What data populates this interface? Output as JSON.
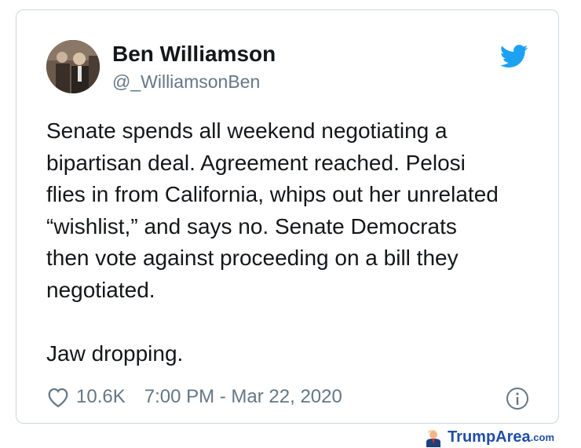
{
  "tweet": {
    "author": {
      "display_name": "Ben Williamson",
      "handle": "@_WilliamsonBen"
    },
    "text_lines": [
      "Senate spends all weekend negotiating a",
      "bipartisan deal. Agreement reached. Pelosi",
      "flies in from California, whips out her unrelated",
      "“wishlist,” and says no. Senate Democrats",
      "then vote against proceeding on a bill they",
      "negotiated."
    ],
    "text_closing": "Jaw dropping.",
    "likes": "10.6K",
    "timestamp": "7:00 PM - Mar 22, 2020",
    "icons": {
      "brand": "twitter-bird-icon",
      "like": "heart-icon",
      "info": "info-icon"
    }
  },
  "watermark": {
    "name": "TrumpArea",
    "tld": ".com",
    "icon": "trump-figure-icon"
  },
  "colors": {
    "twitter_blue": "#1da1f2",
    "text_primary": "#14171a",
    "text_secondary": "#657786",
    "card_border": "#cfd6dc",
    "watermark_blue": "#1f4ea8"
  }
}
